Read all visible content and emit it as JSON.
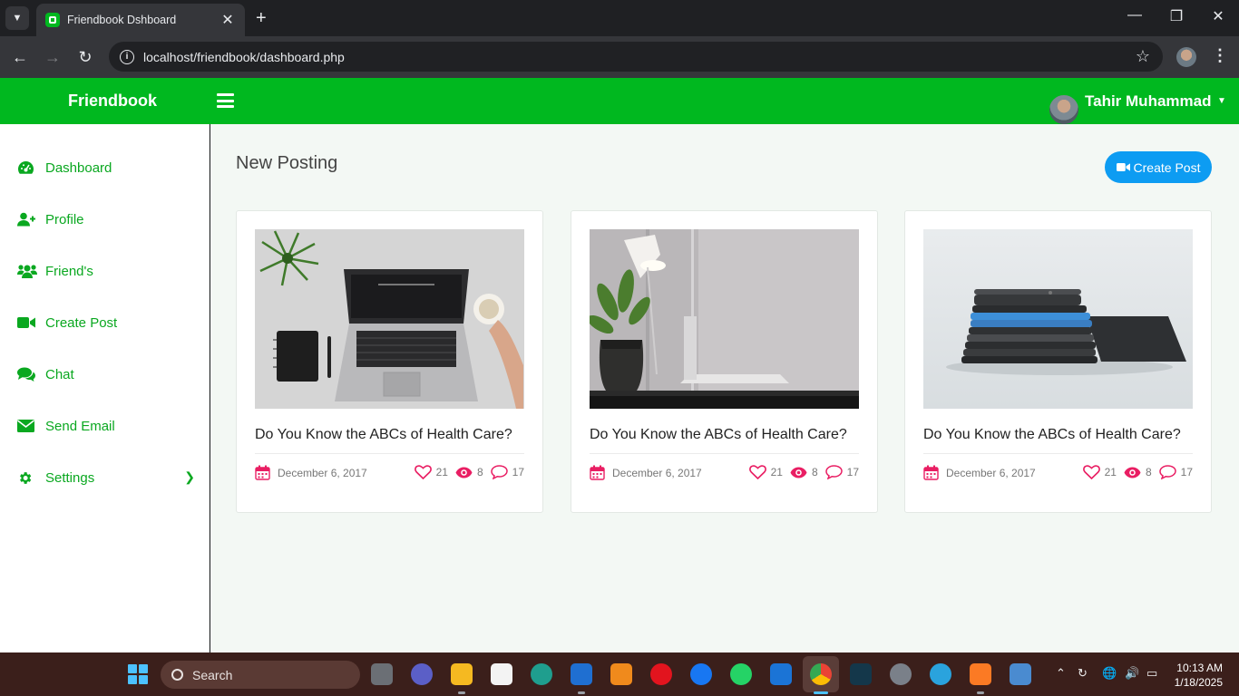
{
  "browser": {
    "tab_title": "Friendbook Dshboard",
    "url": "localhost/friendbook/dashboard.php"
  },
  "header": {
    "brand": "Friendbook",
    "user_name": "Tahir Muhammad"
  },
  "sidebar": {
    "items": [
      {
        "label": "Dashboard",
        "icon": "dashboard-icon"
      },
      {
        "label": "Profile",
        "icon": "user-plus-icon"
      },
      {
        "label": "Friend's",
        "icon": "users-icon"
      },
      {
        "label": "Create Post",
        "icon": "video-icon"
      },
      {
        "label": "Chat",
        "icon": "comments-icon"
      },
      {
        "label": "Send Email",
        "icon": "envelope-icon"
      },
      {
        "label": "Settings",
        "icon": "gear-icon"
      }
    ]
  },
  "main": {
    "title": "New Posting",
    "create_button": "Create Post",
    "posts": [
      {
        "title": "Do You Know the ABCs of Health Care?",
        "date": "December 6, 2017",
        "likes": "21",
        "views": "8",
        "comments": "17"
      },
      {
        "title": "Do You Know the ABCs of Health Care?",
        "date": "December 6, 2017",
        "likes": "21",
        "views": "8",
        "comments": "17"
      },
      {
        "title": "Do You Know the ABCs of Health Care?",
        "date": "December 6, 2017",
        "likes": "21",
        "views": "8",
        "comments": "17"
      }
    ]
  },
  "taskbar": {
    "search_placeholder": "Search",
    "time": "10:13 AM",
    "date": "1/18/2025"
  },
  "colors": {
    "brand_green": "#00b81f",
    "accent_blue": "#0d9cf2",
    "stat_pink": "#e91e63"
  }
}
